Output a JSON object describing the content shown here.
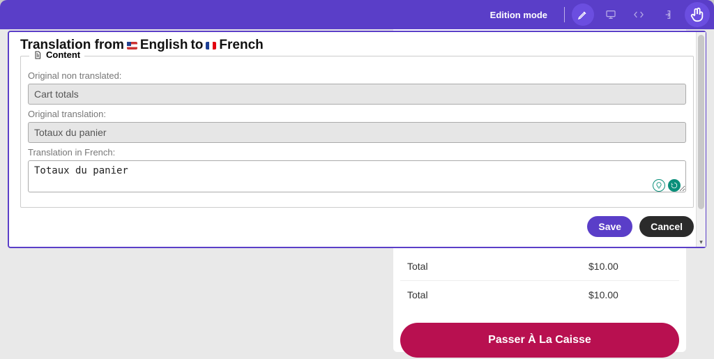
{
  "toolbar": {
    "mode_label": "Edition mode"
  },
  "modal": {
    "title_prefix": "Translation from",
    "lang_from": "English",
    "title_to": "to",
    "lang_to": "French",
    "legend": "Content",
    "labels": {
      "original_non_translated": "Original non translated:",
      "original_translation": "Original translation:",
      "translation_in_french": "Translation in French:"
    },
    "fields": {
      "original_non_translated": "Cart totals",
      "original_translation": "Totaux du panier",
      "translation_in_french": "Totaux du panier"
    },
    "actions": {
      "save": "Save",
      "cancel": "Cancel"
    }
  },
  "cart": {
    "rows": [
      {
        "label": "Total",
        "value": "$10.00"
      },
      {
        "label": "Total",
        "value": "$10.00"
      }
    ],
    "checkout_label": "Passer À La Caisse"
  },
  "colors": {
    "primary": "#5a3ec8",
    "accent": "#b81050"
  }
}
